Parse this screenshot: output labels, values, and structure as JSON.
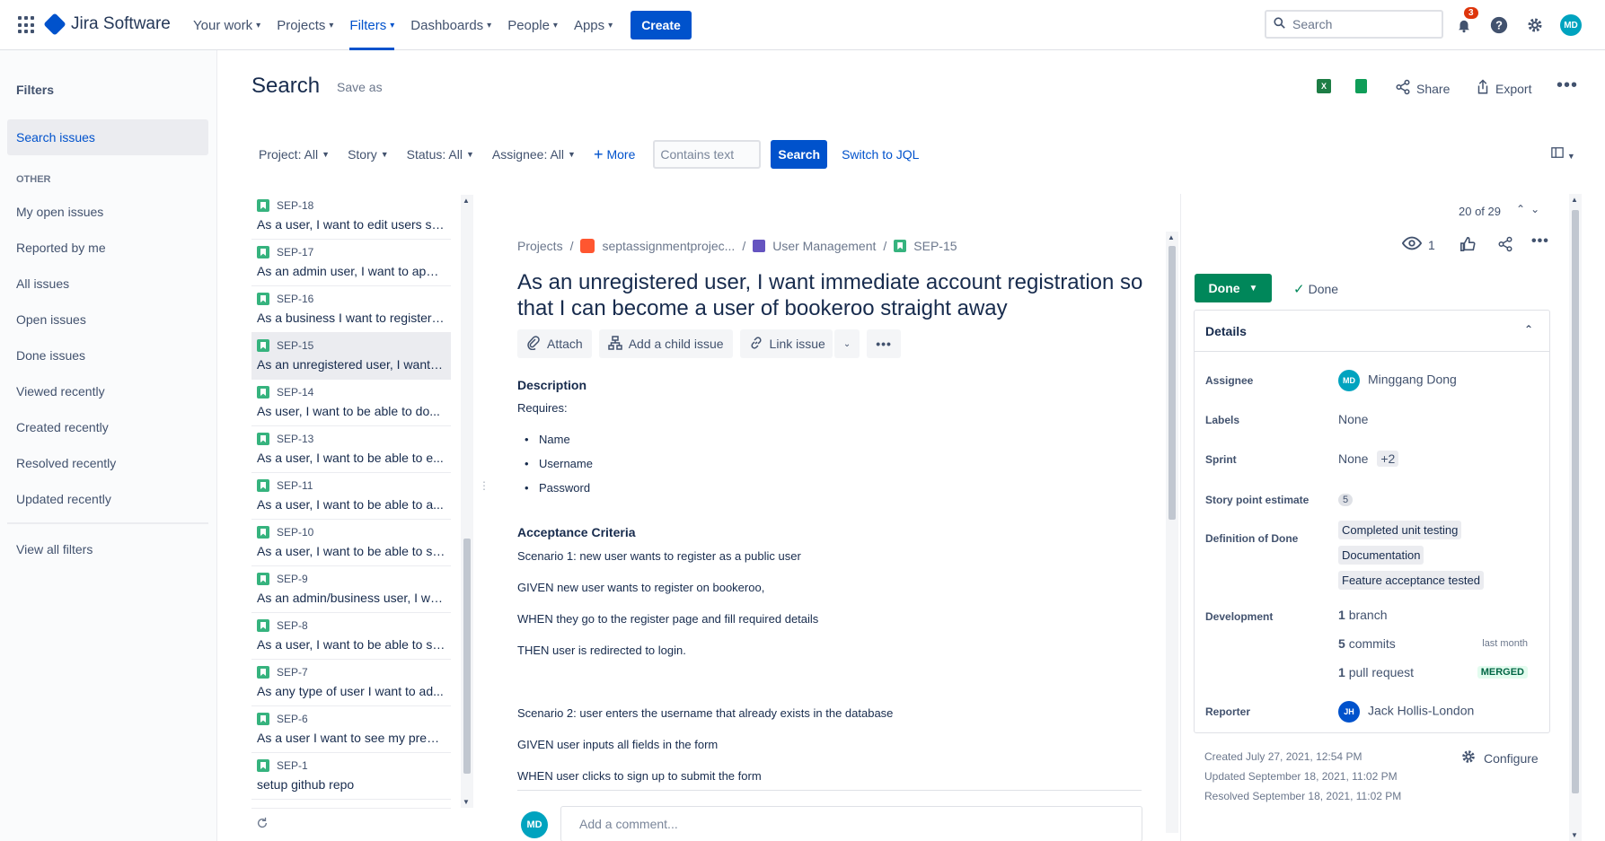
{
  "topnav": {
    "app_name": "Jira Software",
    "items": [
      {
        "label": "Your work",
        "active": false
      },
      {
        "label": "Projects",
        "active": false
      },
      {
        "label": "Filters",
        "active": true
      },
      {
        "label": "Dashboards",
        "active": false
      },
      {
        "label": "People",
        "active": false
      },
      {
        "label": "Apps",
        "active": false
      }
    ],
    "create_label": "Create",
    "search_placeholder": "Search",
    "notification_count": "3",
    "user_initials": "MD"
  },
  "sidebar": {
    "title": "Filters",
    "selected": "Search issues",
    "other_heading": "OTHER",
    "items": [
      "My open issues",
      "Reported by me",
      "All issues",
      "Open issues",
      "Done issues",
      "Viewed recently",
      "Created recently",
      "Resolved recently",
      "Updated recently"
    ],
    "view_all": "View all filters"
  },
  "header": {
    "title": "Search",
    "save_as": "Save as",
    "share": "Share",
    "export": "Export"
  },
  "filters": {
    "project": "Project: All",
    "type": "Story",
    "status": "Status: All",
    "assignee": "Assignee: All",
    "more": "More",
    "contains_placeholder": "Contains text",
    "search": "Search",
    "jql": "Switch to JQL"
  },
  "issues": [
    {
      "key": "SEP-18",
      "summary": "As a user, I want to edit users so...",
      "selected": false
    },
    {
      "key": "SEP-17",
      "summary": "As an admin user, I want to appr...",
      "selected": false
    },
    {
      "key": "SEP-16",
      "summary": "As a business I want to register ...",
      "selected": false
    },
    {
      "key": "SEP-15",
      "summary": "As an unregistered user, I want i...",
      "selected": true
    },
    {
      "key": "SEP-14",
      "summary": "As user, I want to be able to do...",
      "selected": false
    },
    {
      "key": "SEP-13",
      "summary": "As a user, I want to be able to e...",
      "selected": false
    },
    {
      "key": "SEP-11",
      "summary": "As a user, I want to be able to a...",
      "selected": false
    },
    {
      "key": "SEP-10",
      "summary": "As a user, I want to be able to se...",
      "selected": false
    },
    {
      "key": "SEP-9",
      "summary": "As an admin/business user, I wa...",
      "selected": false
    },
    {
      "key": "SEP-8",
      "summary": "As a user, I want to be able to se...",
      "selected": false
    },
    {
      "key": "SEP-7",
      "summary": "As any type of user I want to ad...",
      "selected": false
    },
    {
      "key": "SEP-6",
      "summary": "As a user I want to see my previ...",
      "selected": false
    },
    {
      "key": "SEP-1",
      "summary": "setup github repo",
      "selected": false
    }
  ],
  "detail": {
    "breadcrumbs": {
      "projects": "Projects",
      "project": "septassignmentprojec...",
      "epic": "User Management",
      "key": "SEP-15"
    },
    "title": "As an unregistered user, I want immediate account registration so that I can become a user of bookeroo straight away",
    "actions": {
      "attach": "Attach",
      "child": "Add a child issue",
      "link": "Link issue"
    },
    "description_label": "Description",
    "requires": "Requires:",
    "bullets": [
      "Name",
      "Username",
      "Password"
    ],
    "acceptance_label": "Acceptance Criteria",
    "criteria_lines": [
      "Scenario 1: new user wants to register as a public user",
      "GIVEN new user wants to register on bookeroo,",
      "WHEN they go to the register page and fill required details",
      "THEN user is redirected to login.",
      "Scenario 2: user enters the username that already exists in the database",
      "GIVEN user inputs all fields in the form",
      "WHEN user clicks to sign up to submit the form"
    ],
    "comment_placeholder": "Add a comment...",
    "comment_avatar": "MD"
  },
  "right_panel": {
    "counter": "20 of 29",
    "watchers": "1",
    "status_button": "Done",
    "resolution": "Done",
    "details_title": "Details",
    "assignee_label": "Assignee",
    "assignee": "Minggang Dong",
    "assignee_initials": "MD",
    "labels_label": "Labels",
    "labels": "None",
    "sprint_label": "Sprint",
    "sprint": "None",
    "sprint_extra": "+2",
    "sp_label": "Story point estimate",
    "sp_value": "5",
    "dod_label": "Definition of Done",
    "dod_items": [
      "Completed unit testing",
      "Documentation",
      "Feature acceptance tested"
    ],
    "dev_label": "Development",
    "dev_branch_count": "1",
    "dev_branch": "branch",
    "dev_commits_count": "5",
    "dev_commits": "commits",
    "dev_commits_time": "last month",
    "dev_pr_count": "1",
    "dev_pr": "pull request",
    "dev_pr_status": "MERGED",
    "reporter_label": "Reporter",
    "reporter": "Jack Hollis-London",
    "reporter_initials": "JH",
    "created": "Created July 27, 2021, 12:54 PM",
    "updated": "Updated September 18, 2021, 11:02 PM",
    "resolved": "Resolved September 18, 2021, 11:02 PM",
    "configure": "Configure"
  }
}
